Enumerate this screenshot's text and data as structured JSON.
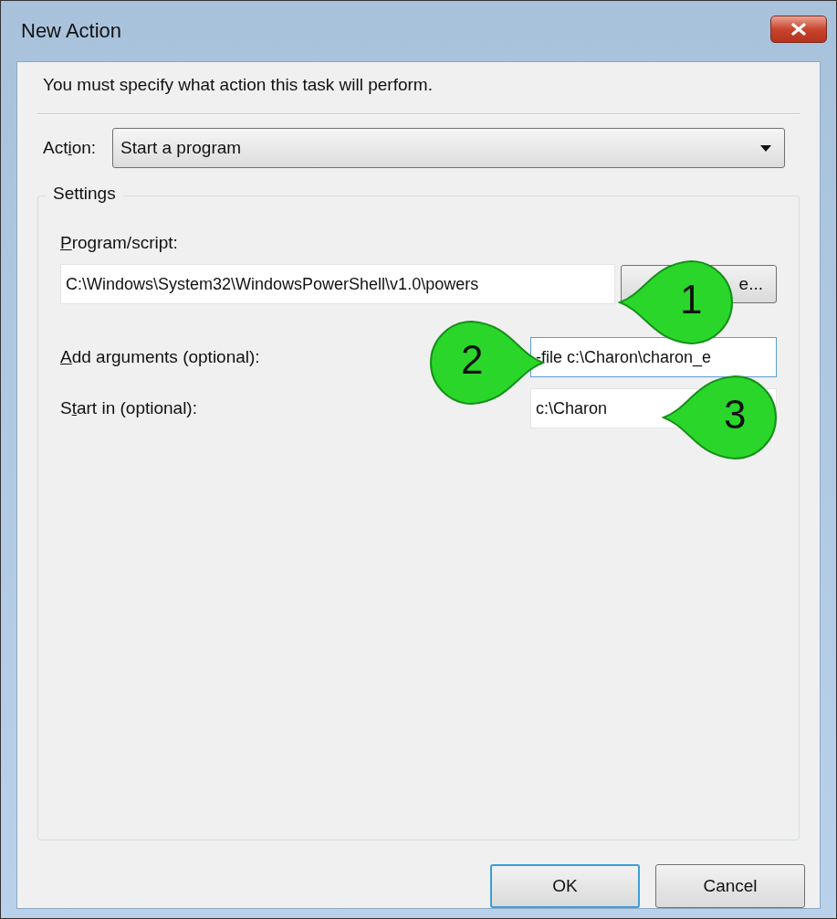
{
  "window": {
    "title": "New Action"
  },
  "instruction": "You must specify what action this task will perform.",
  "action": {
    "label": {
      "before": "Act",
      "key": "i",
      "after": "on:"
    },
    "value": "Start a program"
  },
  "settings": {
    "title": "Settings",
    "fields": [
      {
        "kind": "browse",
        "label": {
          "key": "P",
          "after": "rogram/script:"
        },
        "value": "C:\\Windows\\System32\\WindowsPowerShell\\v1.0\\powers",
        "focused": false,
        "button": "e..."
      },
      {
        "kind": "inline",
        "label": {
          "key": "A",
          "after": "dd arguments (optional):"
        },
        "value": "-file c:\\Charon\\charon_e",
        "focused": true
      },
      {
        "kind": "inline",
        "label": {
          "before": "S",
          "key": "t",
          "after": "art in (optional):"
        },
        "value": "c:\\Charon",
        "focused": false
      }
    ]
  },
  "callouts": [
    {
      "number": "1"
    },
    {
      "number": "2"
    },
    {
      "number": "3"
    }
  ],
  "buttons": [
    {
      "label": "OK",
      "default": true
    },
    {
      "label": "Cancel",
      "default": false
    }
  ]
}
